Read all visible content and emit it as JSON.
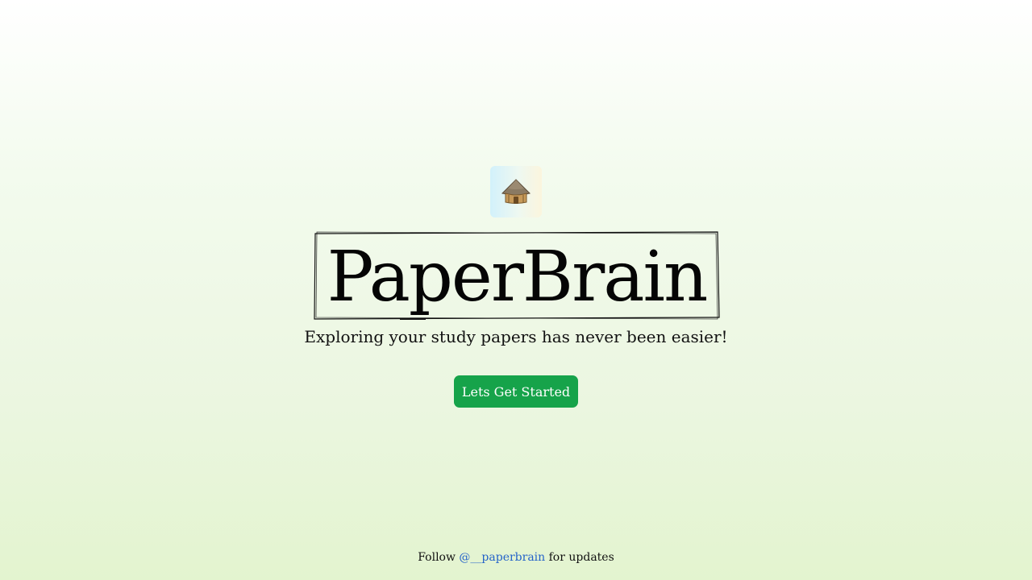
{
  "brand": {
    "icon": "hut-icon",
    "title": "PaperBrain",
    "tagline": "Exploring your study papers has never been easier!"
  },
  "cta": {
    "label": "Lets Get Started",
    "color": "#16a34a"
  },
  "footer": {
    "prefix": "Follow",
    "handle": "@__paperbrain",
    "suffix": "for updates",
    "link_color": "#2563c9"
  }
}
